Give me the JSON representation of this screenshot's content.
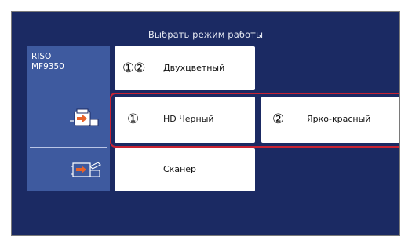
{
  "header": {
    "title": "Выбрать режим работы"
  },
  "device": {
    "brand": "RISO",
    "model": "MF9350",
    "icons": [
      "printer-icon",
      "scanner-icon"
    ]
  },
  "modes": {
    "two_color": {
      "num": "①②",
      "label": "Двухцветный"
    },
    "hd_black": {
      "num": "①",
      "label": "HD Черный"
    },
    "bright_red": {
      "num": "②",
      "label": "Ярко-красный"
    },
    "scanner": {
      "label": "Сканер"
    }
  },
  "colors": {
    "background": "#1b2a63",
    "device_panel": "#3e5a9f",
    "highlight": "#c82333",
    "icon_accent": "#e8632a"
  }
}
